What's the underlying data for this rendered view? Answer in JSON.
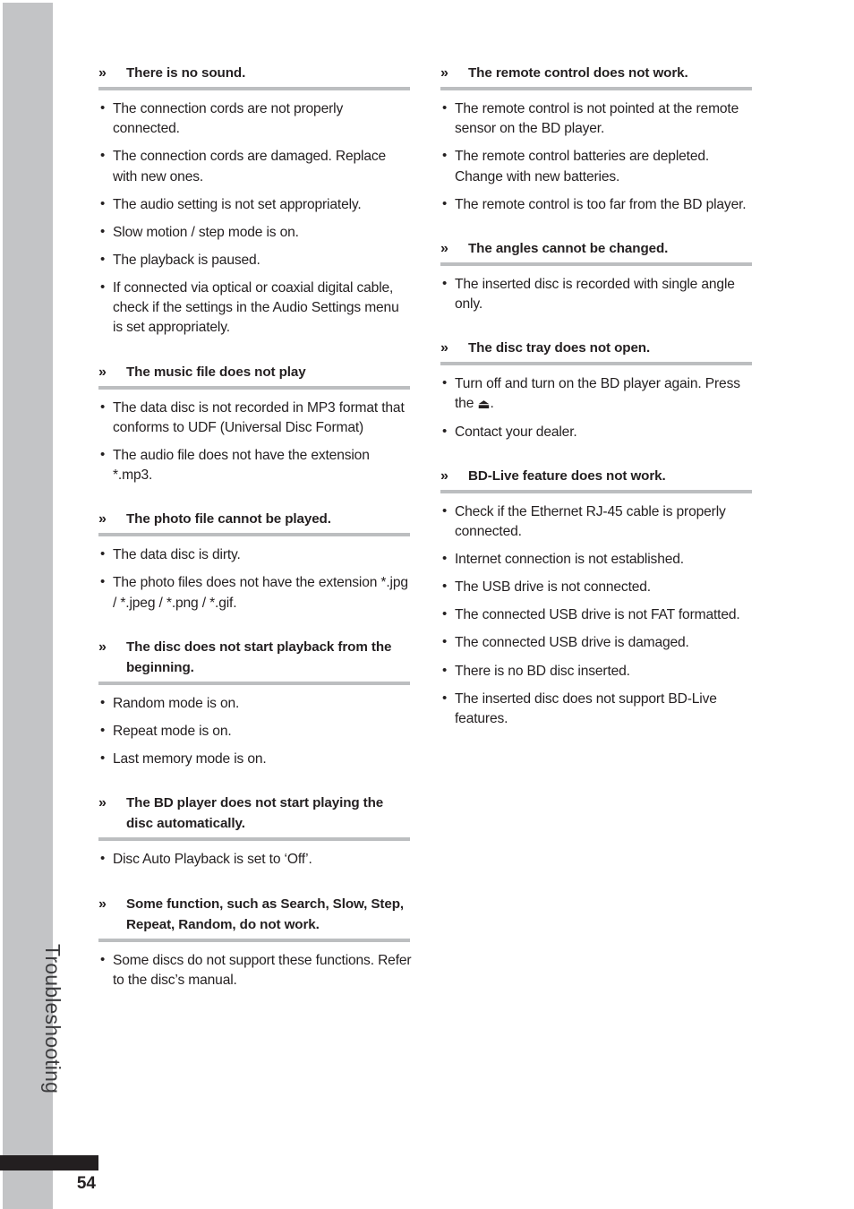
{
  "page": {
    "number": "54",
    "section_tab": "Troubleshooting",
    "guillemet": "»",
    "bullet": "•",
    "accent_gray": "#c3c4c6",
    "rule_gray": "#bcbec0",
    "text_color": "#231f20",
    "footer_bar_color": "#231f20"
  },
  "columns": [
    {
      "id": "left",
      "sections": [
        {
          "heading": "There is no sound.",
          "items": [
            "The connection cords are not properly connected.",
            "The connection cords are damaged. Replace with new ones.",
            "The audio setting is not set appropriately.",
            "Slow motion / step mode is on.",
            "The playback is paused.",
            "If connected via optical or coaxial digital cable, check if the settings in the Audio Settings menu is set appropriately."
          ]
        },
        {
          "heading": "The music file does not play",
          "items": [
            "The data disc is not recorded in MP3 format that conforms to UDF (Universal Disc Format)",
            "The audio file does not have the extension *.mp3."
          ]
        },
        {
          "heading": "The photo file cannot be played.",
          "items": [
            "The data disc is dirty.",
            "The photo files does not have the extension  *.jpg / *.jpeg / *.png / *.gif."
          ]
        },
        {
          "heading": "The disc does not start playback from the beginning.",
          "items": [
            "Random mode is on.",
            "Repeat mode is on.",
            "Last memory mode is on."
          ]
        },
        {
          "heading": "The BD player does not start playing the disc automatically.",
          "items": [
            "Disc Auto Playback is set to ‘Off’."
          ]
        },
        {
          "heading": "Some function, such as Search, Slow, Step, Repeat, Random, do not work.",
          "items": [
            "Some discs do not support these functions. Refer to the disc’s manual."
          ]
        }
      ]
    },
    {
      "id": "right",
      "sections": [
        {
          "heading": "The remote control does not work.",
          "items": [
            "The remote control is not pointed at the remote sensor on the BD player.",
            "The remote control batteries are depleted. Change with new batteries.",
            "The remote control is too far from the BD player."
          ]
        },
        {
          "heading": "The angles cannot be changed.",
          "items": [
            "The inserted disc is recorded with single angle only."
          ]
        },
        {
          "heading": "The disc tray does not open.",
          "items": [
            "Turn off and turn on the BD player again. Press the ⏏.",
            "Contact your dealer."
          ]
        },
        {
          "heading": "BD-Live feature does not work.",
          "items": [
            "Check if the Ethernet RJ-45 cable is properly connected.",
            "Internet connection is not established.",
            "The USB drive is not connected.",
            "The connected USB drive is not FAT formatted.",
            "The connected USB drive is damaged.",
            "There is no BD disc inserted.",
            "The inserted disc does not support BD-Live features."
          ]
        }
      ]
    }
  ]
}
